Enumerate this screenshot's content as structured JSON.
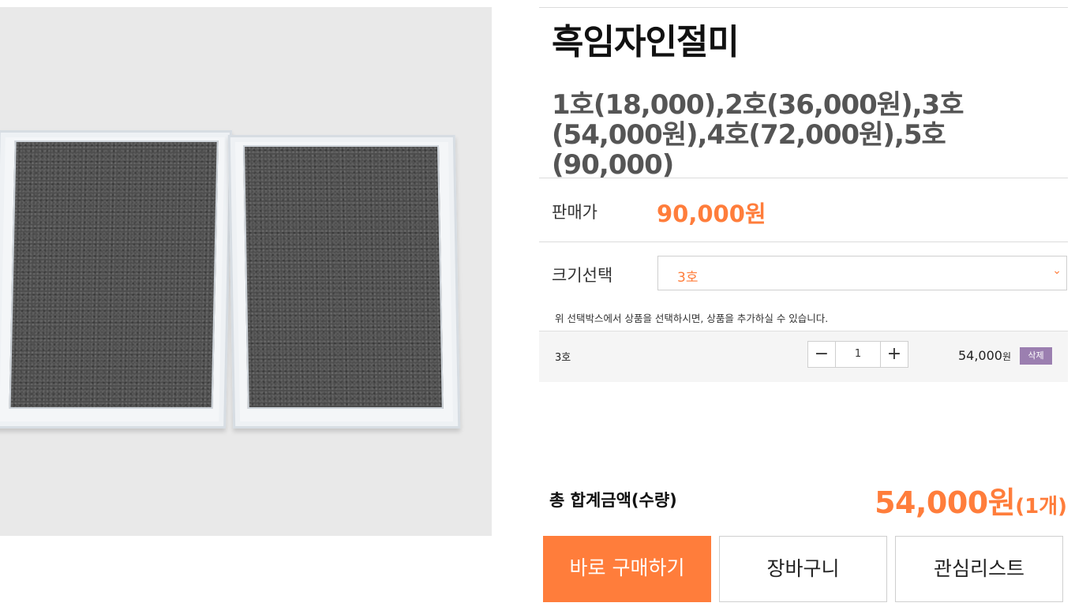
{
  "product": {
    "title": "흑임자인절미",
    "subtitle": "1호(18,000),2호(36,000원),3호(54,000원),4호(72,000원),5호(90,000)",
    "image_alt": "product-photo"
  },
  "price": {
    "label": "판매가",
    "value": "90,000원"
  },
  "size": {
    "label": "크기선택",
    "selected": "3호",
    "chevron": "chevron-down-icon"
  },
  "hint": "위 선택박스에서 상품을 선택하시면, 상품을 추가하실 수 있습니다.",
  "selected_option": {
    "name": "3호",
    "minus": "−",
    "quantity": "1",
    "plus": "+",
    "price": "54,000",
    "price_unit": "원",
    "delete_label": "삭제"
  },
  "total": {
    "label": "총 합계금액(수량)",
    "amount": "54,000원",
    "count": "(1개)"
  },
  "actions": {
    "buy_now": "바로 구매하기",
    "cart": "장바구니",
    "wishlist": "관심리스트"
  },
  "colors": {
    "accent": "#ff7d3b",
    "delete_badge": "#9b7fb0"
  }
}
